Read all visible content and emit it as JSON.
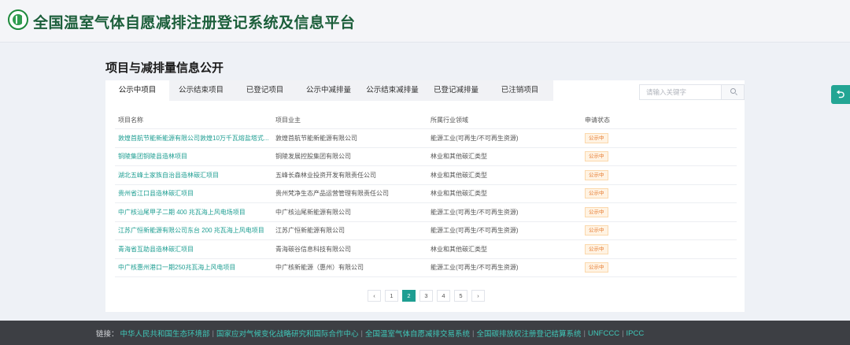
{
  "header": {
    "title": "全国温室气体自愿减排注册登记系统及信息平台"
  },
  "section": {
    "title": "项目与减排量信息公开"
  },
  "tabs": [
    {
      "label": "公示中项目",
      "active": true
    },
    {
      "label": "公示结束项目"
    },
    {
      "label": "已登记项目"
    },
    {
      "label": "公示中减排量"
    },
    {
      "label": "公示结束减排量"
    },
    {
      "label": "已登记减排量"
    },
    {
      "label": "已注销项目"
    }
  ],
  "search": {
    "placeholder": "请输入关键字",
    "icon": "search-icon"
  },
  "table": {
    "headers": [
      "项目名称",
      "项目业主",
      "所属行业领域",
      "申请状态"
    ],
    "rows": [
      {
        "name": "敦煌首航节能新能源有限公司敦煌10万千瓦熔盐塔式...",
        "owner": "敦煌首航节能新能源有限公司",
        "sector": "能源工业(可再生/不可再生资源)",
        "status": "公示中"
      },
      {
        "name": "铜陵集团铜陵县造林项目",
        "owner": "铜陵发展控股集团有限公司",
        "sector": "林业和其他碳汇类型",
        "status": "公示中"
      },
      {
        "name": "湖北五峰土家族自治县造林碳汇项目",
        "owner": "五峰长森林业投资开发有限责任公司",
        "sector": "林业和其他碳汇类型",
        "status": "公示中"
      },
      {
        "name": "贵州省江口县造林碳汇项目",
        "owner": "贵州梵净生态产品运营管理有限责任公司",
        "sector": "林业和其他碳汇类型",
        "status": "公示中"
      },
      {
        "name": "中广核汕尾甲子二期 400 兆瓦海上风电场项目",
        "owner": "中广核汕尾新能源有限公司",
        "sector": "能源工业(可再生/不可再生资源)",
        "status": "公示中"
      },
      {
        "name": "江苏广恒新能源有限公司东台 200 兆瓦海上风电项目",
        "owner": "江苏广恒新能源有限公司",
        "sector": "能源工业(可再生/不可再生资源)",
        "status": "公示中"
      },
      {
        "name": "青海省互助县造林碳汇项目",
        "owner": "青海碳谷信息科技有限公司",
        "sector": "林业和其他碳汇类型",
        "status": "公示中"
      },
      {
        "name": "中广核惠州港口一期250兆瓦海上风电项目",
        "owner": "中广核新能源（惠州）有限公司",
        "sector": "能源工业(可再生/不可再生资源)",
        "status": "公示中"
      }
    ]
  },
  "pagination": {
    "prev": "‹",
    "next": "›",
    "pages": [
      "1",
      "2",
      "3",
      "4",
      "5"
    ],
    "current": "2"
  },
  "float_button": {
    "icon": "return-icon",
    "glyph": "⮌"
  },
  "footer": {
    "label": "链接：",
    "links": [
      "中华人民共和国生态环境部",
      "国家应对气候变化战略研究和国际合作中心",
      "全国温室气体自愿减排交易系统",
      "全国碳排放权注册登记结算系统",
      "UNFCCC",
      "IPCC"
    ],
    "separator": "|"
  },
  "colors": {
    "accent": "#1e9e92",
    "brand": "#1b5e3a",
    "badge": "#e6792e",
    "footer_bg": "#3d3f44"
  }
}
